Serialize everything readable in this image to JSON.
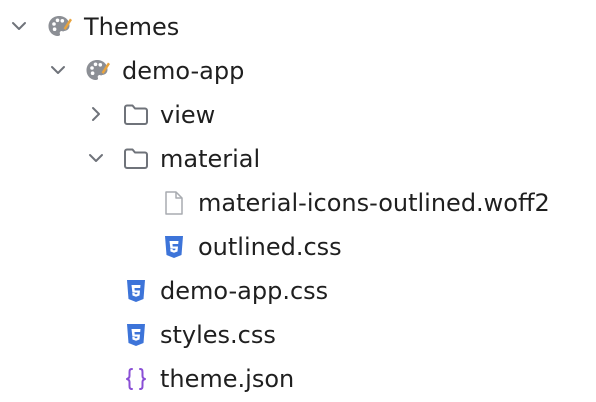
{
  "tree": {
    "root": {
      "label": "Themes",
      "icon": "palette-icon",
      "expanded": true
    },
    "project": {
      "label": "demo-app",
      "icon": "palette-icon",
      "expanded": true
    },
    "view_folder": {
      "label": "view",
      "icon": "folder-icon",
      "expanded": false
    },
    "material_folder": {
      "label": "material",
      "icon": "folder-icon",
      "expanded": true
    },
    "woff2_file": {
      "label": "material-icons-outlined.woff2",
      "icon": "generic-file-icon"
    },
    "outlined_css_file": {
      "label": "outlined.css",
      "icon": "css-file-icon"
    },
    "demo_app_css_file": {
      "label": "demo-app.css",
      "icon": "css-file-icon"
    },
    "styles_css_file": {
      "label": "styles.css",
      "icon": "css-file-icon"
    },
    "theme_json_file": {
      "label": "theme.json",
      "icon": "json-braces-icon"
    }
  },
  "colors": {
    "text": "#1f1f1f",
    "chevron": "#6f737a",
    "folder_stroke": "#6f737a",
    "css_blue": "#3d74d9",
    "json_purple": "#8a4fd6",
    "palette_gray": "#8c8f95",
    "brush_yellow": "#e8a33d"
  }
}
